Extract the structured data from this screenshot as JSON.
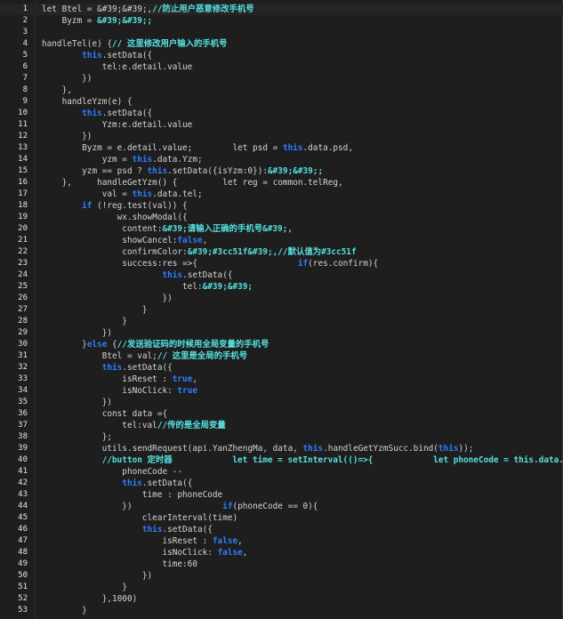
{
  "colors": {
    "background": "#1e1e1e",
    "text": "#d4d4d4",
    "keyword": "#2f7cff",
    "comment": "#57e0e0",
    "line_number": "#e6e6e6"
  },
  "lines": [
    [
      {
        "t": "let Btel = &#39;&#39;,"
      },
      {
        "t": "//防止用户恶意修改手机号",
        "c": "cm"
      }
    ],
    [
      {
        "t": "    Byzm = "
      },
      {
        "t": "&#39;&#39;;",
        "c": "st"
      }
    ],
    [],
    [
      {
        "t": "handleTel(e) {"
      },
      {
        "t": "// 这里修改用户输入的手机号",
        "c": "cm"
      }
    ],
    [
      {
        "t": "        "
      },
      {
        "t": "this",
        "c": "kw"
      },
      {
        "t": ".setData({"
      }
    ],
    [
      {
        "t": "            tel:e.detail.value"
      }
    ],
    [
      {
        "t": "        })"
      }
    ],
    [
      {
        "t": "    },"
      }
    ],
    [
      {
        "t": "    handleYzm(e) {"
      }
    ],
    [
      {
        "t": "        "
      },
      {
        "t": "this",
        "c": "kw"
      },
      {
        "t": ".setData({"
      }
    ],
    [
      {
        "t": "            Yzm:e.detail.value"
      }
    ],
    [
      {
        "t": "        })"
      }
    ],
    [
      {
        "t": "        Byzm = e.detail.value;        let psd = "
      },
      {
        "t": "this",
        "c": "kw"
      },
      {
        "t": ".data.psd,"
      }
    ],
    [
      {
        "t": "            yzm = "
      },
      {
        "t": "this",
        "c": "kw"
      },
      {
        "t": ".data.Yzm;"
      }
    ],
    [
      {
        "t": "        yzm == psd ? "
      },
      {
        "t": "this",
        "c": "kw"
      },
      {
        "t": ".setData({isYzm:0}):"
      },
      {
        "t": "&#39;&#39;;",
        "c": "st"
      }
    ],
    [
      {
        "t": "    },     handleGetYzm() {         let reg = common.telReg,"
      }
    ],
    [
      {
        "t": "            val = "
      },
      {
        "t": "this",
        "c": "kw"
      },
      {
        "t": ".data.tel;"
      }
    ],
    [
      {
        "t": "        "
      },
      {
        "t": "if",
        "c": "kw"
      },
      {
        "t": " (!reg.test(val)) {"
      }
    ],
    [
      {
        "t": "               wx.showModal({"
      }
    ],
    [
      {
        "t": "                content:"
      },
      {
        "t": "&#39;请输入正确的手机号&#39;,",
        "c": "st"
      }
    ],
    [
      {
        "t": "                showCancel:"
      },
      {
        "t": "false",
        "c": "kw"
      },
      {
        "t": ","
      }
    ],
    [
      {
        "t": "                confirmColor:"
      },
      {
        "t": "&#39;#3cc51f&#39;,//默认值为#3cc51f",
        "c": "st"
      }
    ],
    [
      {
        "t": "                success:res =>{                    "
      },
      {
        "t": "if",
        "c": "kw"
      },
      {
        "t": "(res.confirm){"
      }
    ],
    [
      {
        "t": "                        "
      },
      {
        "t": "this",
        "c": "kw"
      },
      {
        "t": ".setData({"
      }
    ],
    [
      {
        "t": "                            tel:"
      },
      {
        "t": "&#39;&#39;",
        "c": "st"
      }
    ],
    [
      {
        "t": "                        })"
      }
    ],
    [
      {
        "t": "                    }"
      }
    ],
    [
      {
        "t": "                }"
      }
    ],
    [
      {
        "t": "            })"
      }
    ],
    [
      {
        "t": "        }"
      },
      {
        "t": "else",
        "c": "kw"
      },
      {
        "t": " {"
      },
      {
        "t": "//发送验证码的时候用全局变量的手机号",
        "c": "cm"
      }
    ],
    [
      {
        "t": "            Btel = val;"
      },
      {
        "t": "// 这里是全局的手机号",
        "c": "cm"
      }
    ],
    [
      {
        "t": "            "
      },
      {
        "t": "this",
        "c": "kw"
      },
      {
        "t": ".setData({"
      }
    ],
    [
      {
        "t": "                isReset : "
      },
      {
        "t": "true",
        "c": "kw"
      },
      {
        "t": ","
      }
    ],
    [
      {
        "t": "                isNoClick: "
      },
      {
        "t": "true",
        "c": "kw"
      }
    ],
    [
      {
        "t": "            })"
      }
    ],
    [
      {
        "t": "            const data ={"
      }
    ],
    [
      {
        "t": "                tel:val"
      },
      {
        "t": "//传的是全局变量",
        "c": "cm"
      }
    ],
    [
      {
        "t": "            };"
      }
    ],
    [
      {
        "t": "            utils.sendRequest(api.YanZhengMa, data, "
      },
      {
        "t": "this",
        "c": "kw"
      },
      {
        "t": ".handleGetYzmSucc.bind("
      },
      {
        "t": "this",
        "c": "kw"
      },
      {
        "t": "));"
      }
    ],
    [
      {
        "t": "            "
      },
      {
        "t": "//button 定时器            let time = setInterval(()=>{            let phoneCode = this.data.time;",
        "c": "cm"
      }
    ],
    [
      {
        "t": "                phoneCode --"
      }
    ],
    [
      {
        "t": "                "
      },
      {
        "t": "this",
        "c": "kw"
      },
      {
        "t": ".setData({"
      }
    ],
    [
      {
        "t": "                    time : phoneCode"
      }
    ],
    [
      {
        "t": "                })                  "
      },
      {
        "t": "if",
        "c": "kw"
      },
      {
        "t": "(phoneCode == 0){"
      }
    ],
    [
      {
        "t": "                    clearInterval(time)"
      }
    ],
    [
      {
        "t": "                    "
      },
      {
        "t": "this",
        "c": "kw"
      },
      {
        "t": ".setData({"
      }
    ],
    [
      {
        "t": "                        isReset : "
      },
      {
        "t": "false",
        "c": "kw"
      },
      {
        "t": ","
      }
    ],
    [
      {
        "t": "                        isNoClick: "
      },
      {
        "t": "false",
        "c": "kw"
      },
      {
        "t": ","
      }
    ],
    [
      {
        "t": "                        time:60"
      }
    ],
    [
      {
        "t": "                    })"
      }
    ],
    [
      {
        "t": "                }"
      }
    ],
    [
      {
        "t": "            },1000)"
      }
    ],
    [
      {
        "t": "        }"
      }
    ]
  ]
}
